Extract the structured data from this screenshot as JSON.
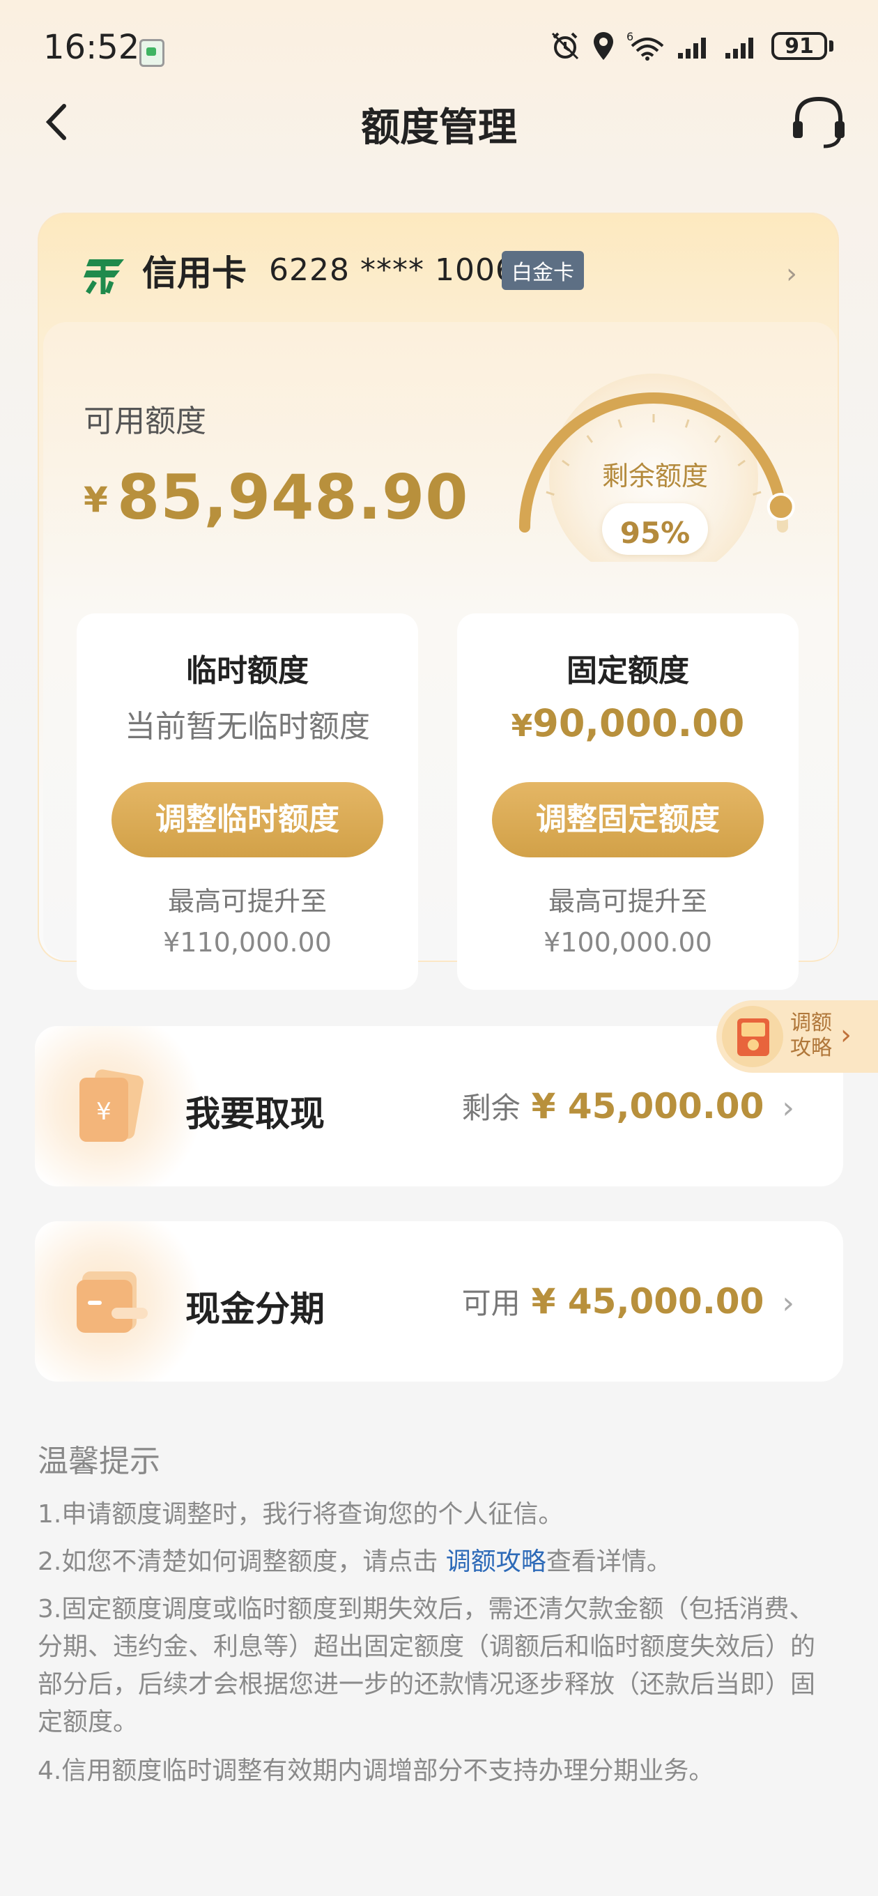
{
  "status": {
    "time": "16:52",
    "battery": "91",
    "network": "6"
  },
  "nav": {
    "title": "额度管理"
  },
  "card": {
    "type": "信用卡",
    "number": "6228 **** 1006",
    "tier": "白金卡",
    "available_label": "可用额度",
    "available_currency": "¥",
    "available_amount": "85,948.90",
    "gauge_label": "剩余额度",
    "gauge_value": "95%",
    "gauge_fraction": 0.95
  },
  "temp": {
    "title": "临时额度",
    "status": "当前暂无临时额度",
    "button": "调整临时额度",
    "max_label": "最高可提升至",
    "max_value": "¥110,000.00"
  },
  "fixed": {
    "title": "固定额度",
    "currency": "¥",
    "value": "90,000.00",
    "button": "调整固定额度",
    "max_label": "最高可提升至",
    "max_value": "¥100,000.00"
  },
  "strategy": {
    "line1": "调额",
    "line2": "攻略"
  },
  "rows": [
    {
      "label": "我要取现",
      "prefix": "剩余",
      "value": "¥ 45,000.00"
    },
    {
      "label": "现金分期",
      "prefix": "可用",
      "value": "¥ 45,000.00"
    }
  ],
  "tips": {
    "title": "温馨提示",
    "t1": "1.申请额度调整时，我行将查询您的个人征信。",
    "t2_a": "2.如您不清楚如何调整额度，请点击 ",
    "t2_link": "调额攻略",
    "t2_b": "查看详情。",
    "t3": "3.固定额度调度或临时额度到期失效后，需还清欠款金额（包括消费、分期、违约金、利息等）超出固定额度（调额后和临时额度失效后）的部分后，后续才会根据您进一步的还款情况逐步释放（还款后当即）固定额度。",
    "t4": "4.信用额度临时调整有效期内调增部分不支持办理分期业务。"
  },
  "colors": {
    "gold": "#b8903c",
    "button_gold": "#d9aa55",
    "link": "#2d6ab8",
    "tier_badge": "#5d6f84",
    "logo_green": "#1f8a4c"
  }
}
